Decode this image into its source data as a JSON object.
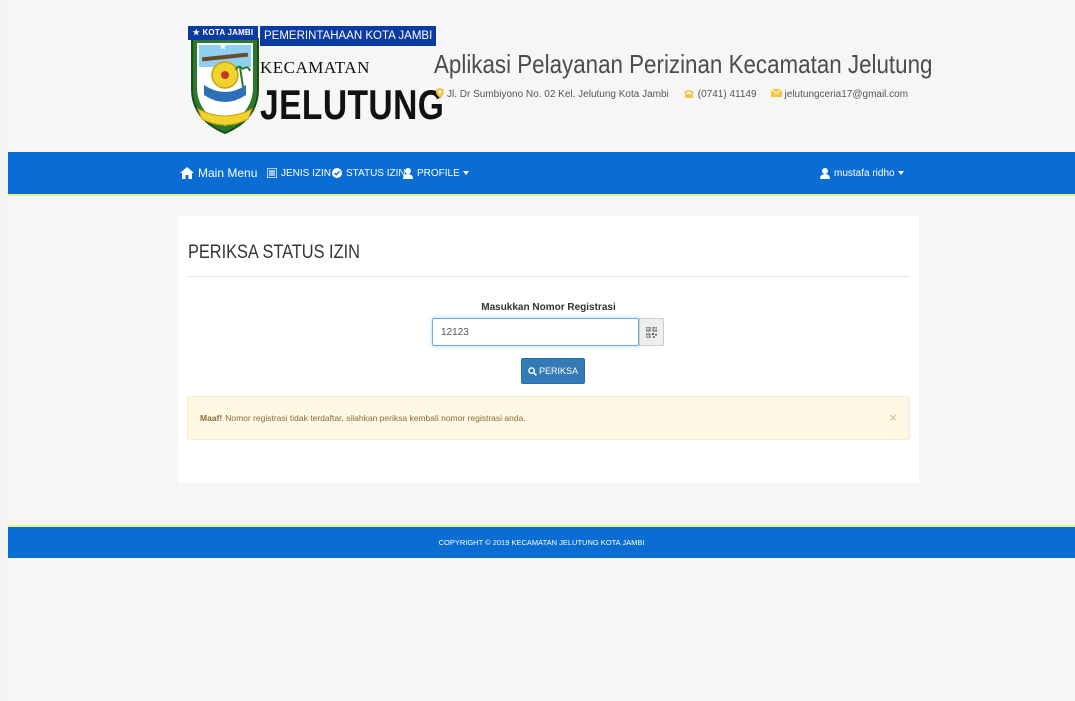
{
  "header": {
    "logo_badge": "★ KOTA JAMBI ★",
    "logo_govt": "PEMERINTAHAAN KOTA JAMBI",
    "logo_kecamatan": "KECAMATAN",
    "logo_name": "JELUTUNG",
    "app_title": "Aplikasi Pelayanan Perizinan Kecamatan Jelutung",
    "address": "Jl. Dr Sumbiyono No. 02 Kel. Jelutung Kota Jambi",
    "phone": "(0741) 41149",
    "email": "jelutungceria17@gmail.com",
    "icons": {
      "address": "map-pin-icon",
      "phone": "phone-icon",
      "email": "envelope-icon"
    }
  },
  "nav": {
    "main_menu": "Main Menu",
    "jenis_izin": "JENIS IZIN",
    "status_izin": "STATUS IZIN",
    "profile": "PROFILE",
    "user": "mustafa ridho"
  },
  "main": {
    "title": "PERIKSA STATUS IZIN",
    "input_label": "Masukkan Nomor Registrasi",
    "input_value": "12123",
    "button_label": "PERIKSA",
    "alert_strong": "Maaf!",
    "alert_text": "Nomor registrasi tidak terdaftar, silahkan periksa kembali nomor registrasi anda.",
    "alert_close": "×"
  },
  "footer": {
    "text": "COPYRIGHT © 2019 KECAMATAN JELUTUNG KOTA JAMBI"
  },
  "colors": {
    "navbar": "#0a6dd4",
    "accent_line": "#e8f28a",
    "button": "#337ab7",
    "alert_bg": "#fcf8e3",
    "logo_badge": "#0b3aa3"
  }
}
